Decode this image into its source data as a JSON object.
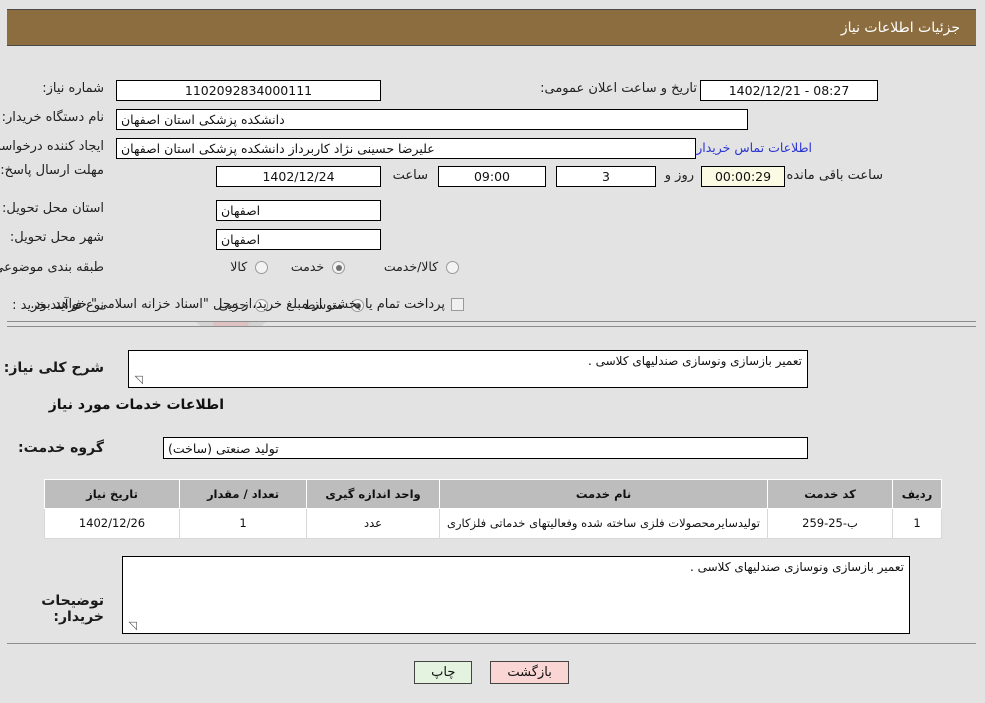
{
  "header": {
    "title": "جزئیات اطلاعات نیاز"
  },
  "watermark": {
    "text": "AriaTender.net"
  },
  "form": {
    "need_number": {
      "label": "شماره نیاز:",
      "value": "1102092834000111"
    },
    "announce_datetime": {
      "label": "تاریخ و ساعت اعلان عمومی:",
      "value": "08:27 - 1402/12/21"
    },
    "buyer_org": {
      "label": "نام دستگاه خریدار:",
      "value": "دانشکده پزشکی استان اصفهان"
    },
    "request_creator": {
      "label": "ایجاد کننده درخواست:",
      "value": "علیرضا حسینی نژاد کاربرداز دانشکده پزشکی استان اصفهان"
    },
    "contact_link": "اطلاعات تماس خریدار",
    "deadline": {
      "label": "مهلت ارسال پاسخ: تا تاریخ:",
      "value": "1402/12/24"
    },
    "deadline_hour": {
      "label": "ساعت",
      "value": "09:00"
    },
    "days_left": {
      "value": "3",
      "unit": "روز و"
    },
    "timer": {
      "value": "00:00:29",
      "suffix": "ساعت باقی مانده"
    },
    "province": {
      "label": "استان محل تحویل:",
      "value": "اصفهان"
    },
    "city": {
      "label": "شهر محل تحویل:",
      "value": "اصفهان"
    },
    "category": {
      "label": "طبقه بندی موضوعی:",
      "options": [
        {
          "label": "کالا",
          "selected": false
        },
        {
          "label": "خدمت",
          "selected": true
        },
        {
          "label": "کالا/خدمت",
          "selected": false
        }
      ]
    },
    "purchase_type": {
      "label": "نوع فرآیند خرید :",
      "options": [
        {
          "label": "جزیی",
          "selected": false
        },
        {
          "label": "متوسط",
          "selected": true
        }
      ]
    },
    "treasury_note": {
      "checked": false,
      "text": "پرداخت تمام یا بخشی از مبلغ خرید،از محل \"اسناد خزانه اسلامی\" خواهد بود."
    }
  },
  "middle": {
    "general_desc": {
      "label": "شرح کلی نیاز:",
      "value": "تعمیر بازسازی ونوسازی صندلیهای کلاسی ."
    },
    "services_section_title": "اطلاعات خدمات مورد نیاز",
    "service_group": {
      "label": "گروه خدمت:",
      "value": "تولید صنعتی (ساخت)"
    },
    "buyer_notes": {
      "label": "توضیحات خریدار:",
      "value": "تعمیر بازسازی ونوسازی صندلیهای کلاسی ."
    }
  },
  "table": {
    "columns": [
      "ردیف",
      "کد خدمت",
      "نام خدمت",
      "واحد اندازه گیری",
      "تعداد / مقدار",
      "تاریخ نیاز"
    ],
    "rows": [
      {
        "row_no": "1",
        "service_code": "ب-25-259",
        "service_name": "تولیدسایرمحصولات فلزی ساخته شده وفعالیتهای خدماتی فلزکاری",
        "unit": "عدد",
        "quantity": "1",
        "need_date": "1402/12/26"
      }
    ]
  },
  "buttons": {
    "print": "چاپ",
    "back": "بازگشت"
  },
  "colors": {
    "header_bg": "#8c6d3f",
    "page_bg": "#e3e3e3",
    "link": "#2a34d2",
    "timer_bg": "#fbfbe4",
    "print_bg": "#e4f3e0",
    "back_bg": "#f9d6d3"
  }
}
